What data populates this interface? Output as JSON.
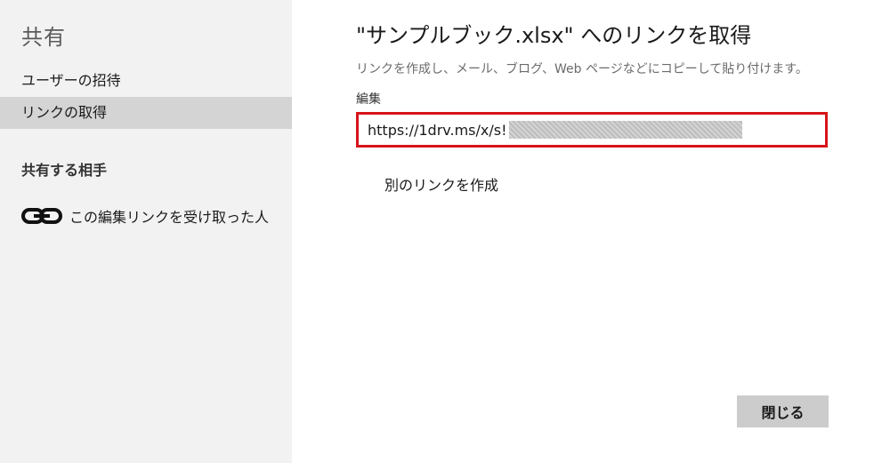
{
  "sidebar": {
    "title": "共有",
    "items": [
      {
        "label": "ユーザーの招待"
      },
      {
        "label": "リンクの取得"
      }
    ],
    "shared_with_heading": "共有する相手",
    "shared_entry": {
      "icon": "link-icon",
      "label": "この編集リンクを受け取った人"
    }
  },
  "main": {
    "title": "\"サンプルブック.xlsx\" へのリンクを取得",
    "subtitle": "リンクを作成し、メール、ブログ、Web ページなどにコピーして貼り付けます。",
    "permission_label": "編集",
    "link": {
      "visible_text": "https://1drv.ms/x/s!",
      "redacted": true,
      "highlight_color": "#d7141a"
    },
    "create_another_link": "別のリンクを作成",
    "close_button": "閉じる"
  }
}
